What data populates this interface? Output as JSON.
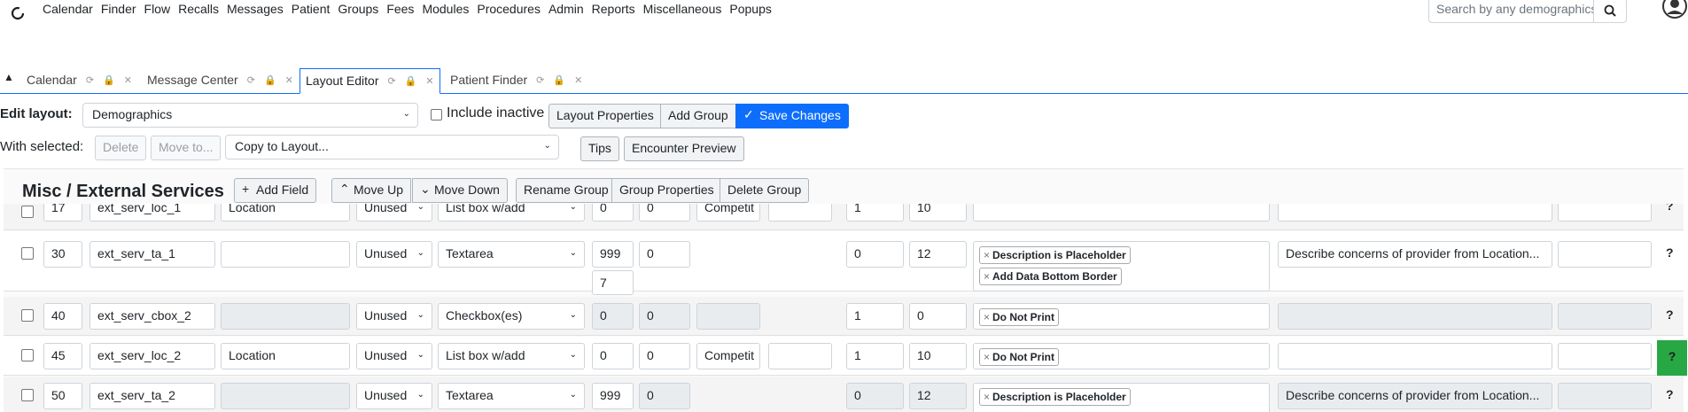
{
  "nav": {
    "menu": [
      "Calendar",
      "Finder",
      "Flow",
      "Recalls",
      "Messages",
      "Patient",
      "Groups",
      "Fees",
      "Modules",
      "Procedures",
      "Admin",
      "Reports",
      "Miscellaneous",
      "Popups"
    ],
    "search_placeholder": "Search by any demographics"
  },
  "tabs": [
    {
      "label": "Calendar"
    },
    {
      "label": "Message Center"
    },
    {
      "label": "Layout Editor"
    },
    {
      "label": "Patient Finder"
    }
  ],
  "toolbar": {
    "edit_layout_label": "Edit layout:",
    "layout_value": "Demographics",
    "include_inactive": "Include inactive",
    "layout_properties": "Layout Properties",
    "add_group": "Add Group",
    "save_changes": "Save Changes",
    "with_selected": "With selected:",
    "delete": "Delete",
    "move_to": "Move to...",
    "copy_to_layout": "Copy to Layout...",
    "tips": "Tips",
    "encounter_preview": "Encounter Preview"
  },
  "group": {
    "title": "Misc / External Services",
    "add_field": "Add Field",
    "move_up": "Move Up",
    "move_down": "Move Down",
    "rename_group": "Rename Group",
    "group_properties": "Group Properties",
    "delete_group": "Delete Group"
  },
  "rows": [
    {
      "order": "17",
      "id": "ext_serv_loc_1",
      "label": "Location",
      "uor": "Unused",
      "type": "List box w/add",
      "w": "0",
      "h": "0",
      "list": "Competit",
      "span1": "1",
      "span2": "10",
      "options": [],
      "desc": ""
    },
    {
      "order": "30",
      "id": "ext_serv_ta_1",
      "label": "",
      "uor": "Unused",
      "type": "Textarea",
      "w": "999",
      "w2": "7",
      "h": "0",
      "list": "",
      "span1": "0",
      "span2": "12",
      "options": [
        "Description is Placeholder",
        "Add Data Bottom Border"
      ],
      "desc": "Describe concerns of provider from Location..."
    },
    {
      "order": "40",
      "id": "ext_serv_cbox_2",
      "label": "",
      "uor": "Unused",
      "type": "Checkbox(es)",
      "w": "0",
      "h": "0",
      "list": "",
      "span1": "1",
      "span2": "0",
      "options": [
        "Do Not Print"
      ],
      "desc": ""
    },
    {
      "order": "45",
      "id": "ext_serv_loc_2",
      "label": "Location",
      "uor": "Unused",
      "type": "List box w/add",
      "w": "0",
      "h": "0",
      "list": "Competit",
      "span1": "1",
      "span2": "10",
      "options": [
        "Do Not Print"
      ],
      "desc": ""
    },
    {
      "order": "50",
      "id": "ext_serv_ta_2",
      "label": "",
      "uor": "Unused",
      "type": "Textarea",
      "w": "999",
      "h": "0",
      "list": "",
      "span1": "0",
      "span2": "12",
      "options": [
        "Description is Placeholder"
      ],
      "desc": "Describe concerns of provider from Location..."
    }
  ],
  "help": "?"
}
